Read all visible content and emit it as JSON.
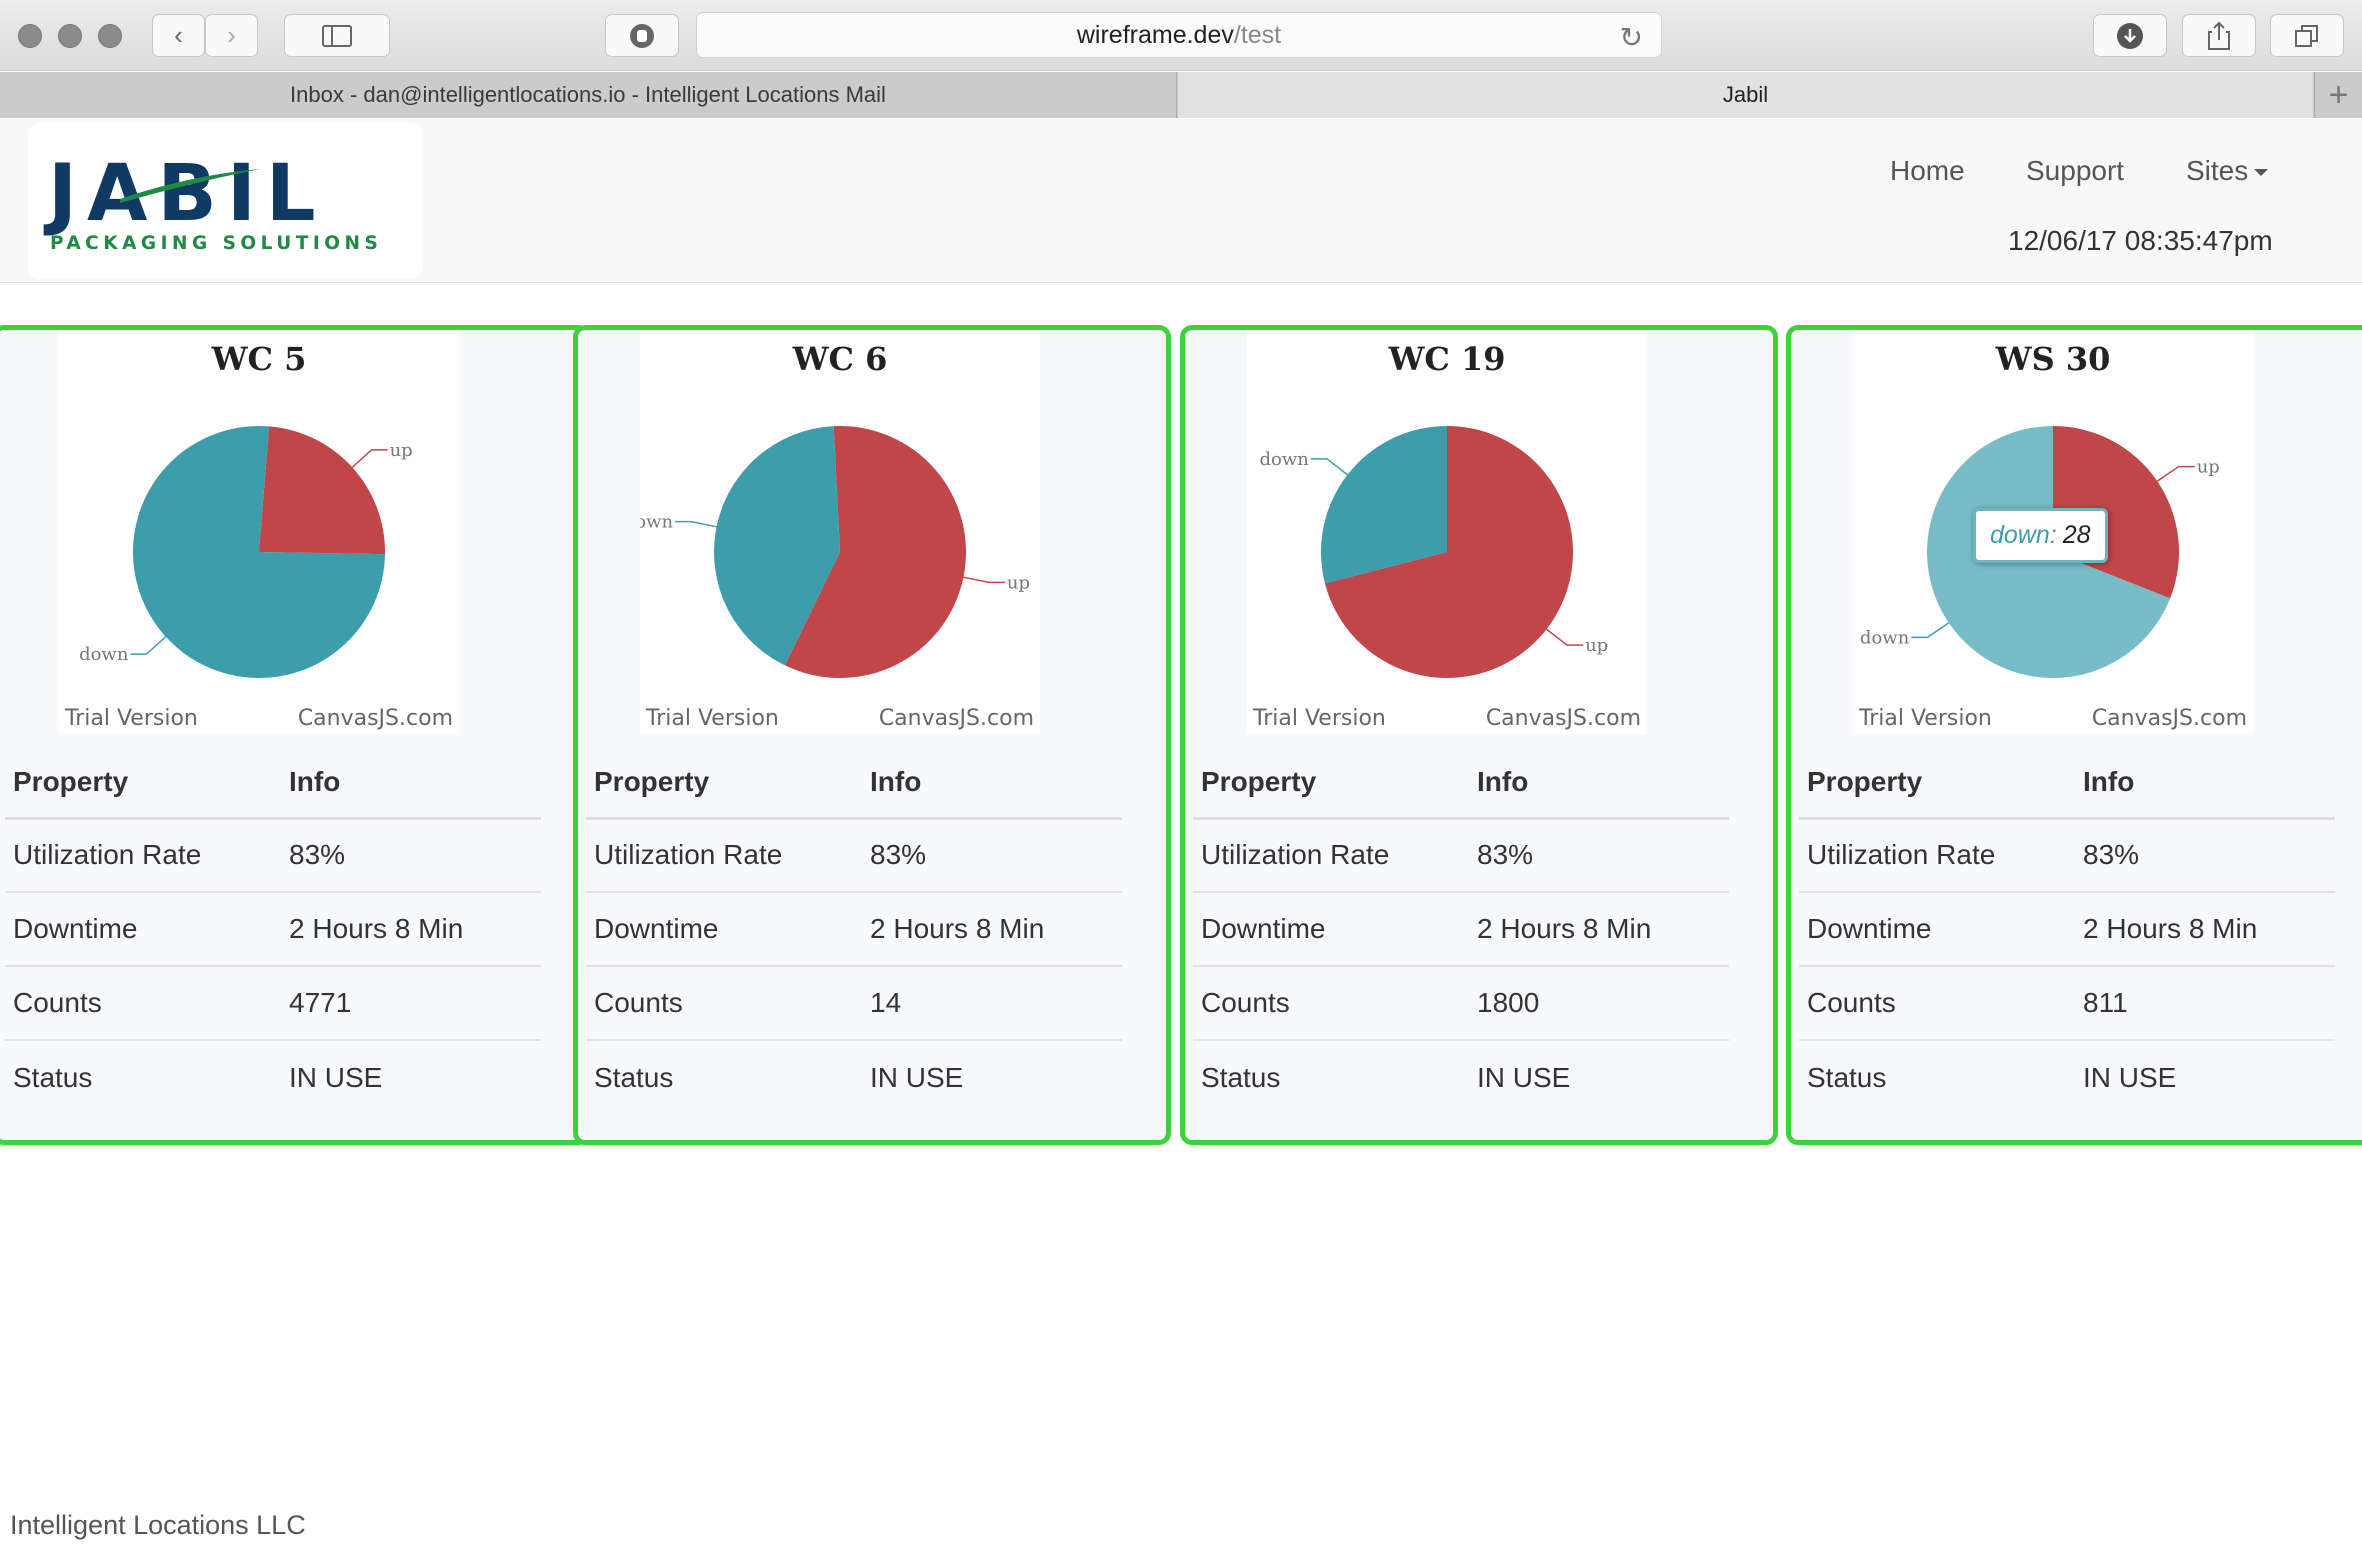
{
  "browser": {
    "url_host": "wireframe.dev",
    "url_path": "/test",
    "tabs": [
      {
        "label": "Inbox - dan@intelligentlocations.io - Intelligent Locations Mail"
      },
      {
        "label": "Jabil"
      }
    ],
    "new_tab": "+"
  },
  "logo": {
    "word": "JABIL",
    "sub": "PACKAGING SOLUTIONS"
  },
  "nav": {
    "home": "Home",
    "support": "Support",
    "sites": "Sites",
    "datetime": "12/06/17 08:35:47pm"
  },
  "table_headers": {
    "property": "Property",
    "info": "Info"
  },
  "watermark": {
    "trial": "Trial Version",
    "brand": "CanvasJS.com"
  },
  "colors": {
    "up": "#c0464a",
    "down": "#3d9dab",
    "down_hover": "#77bcc6",
    "card_border": "#3fd13c"
  },
  "cards": [
    {
      "title": "WC 5",
      "rows": [
        {
          "property": "Utilization Rate",
          "info": "83%"
        },
        {
          "property": "Downtime",
          "info": "2 Hours 8 Min"
        },
        {
          "property": "Counts",
          "info": "4771"
        },
        {
          "property": "Status",
          "info": "IN USE"
        }
      ]
    },
    {
      "title": "WC 6",
      "rows": [
        {
          "property": "Utilization Rate",
          "info": "83%"
        },
        {
          "property": "Downtime",
          "info": "2 Hours 8 Min"
        },
        {
          "property": "Counts",
          "info": "14"
        },
        {
          "property": "Status",
          "info": "IN USE"
        }
      ]
    },
    {
      "title": "WC 19",
      "rows": [
        {
          "property": "Utilization Rate",
          "info": "83%"
        },
        {
          "property": "Downtime",
          "info": "2 Hours 8 Min"
        },
        {
          "property": "Counts",
          "info": "1800"
        },
        {
          "property": "Status",
          "info": "IN USE"
        }
      ]
    },
    {
      "title": "WS 30",
      "rows": [
        {
          "property": "Utilization Rate",
          "info": "83%"
        },
        {
          "property": "Downtime",
          "info": "2 Hours 8 Min"
        },
        {
          "property": "Counts",
          "info": "811"
        },
        {
          "property": "Status",
          "info": "IN USE"
        }
      ]
    }
  ],
  "chart_data": [
    {
      "type": "pie",
      "title": "WC 5",
      "categories": [
        "up",
        "down"
      ],
      "values": [
        24,
        76
      ]
    },
    {
      "type": "pie",
      "title": "WC 6",
      "categories": [
        "up",
        "down"
      ],
      "values": [
        58,
        42
      ]
    },
    {
      "type": "pie",
      "title": "WC 19",
      "categories": [
        "up",
        "down"
      ],
      "values": [
        71,
        29
      ]
    },
    {
      "type": "pie",
      "title": "WS 30",
      "categories": [
        "up",
        "down"
      ],
      "values": [
        31,
        69
      ],
      "tooltip": {
        "label": "down:",
        "value": "28"
      }
    }
  ],
  "footer": "Intelligent Locations LLC"
}
